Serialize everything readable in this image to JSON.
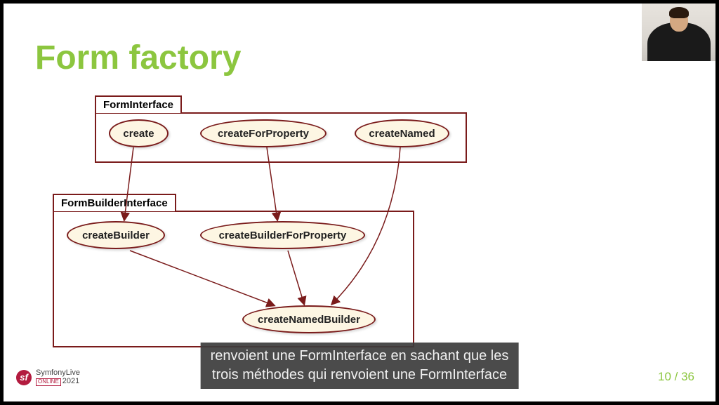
{
  "title": "Form factory",
  "boxes": {
    "box1_label": "FormInterface",
    "box2_label": "FormBuilderInterface"
  },
  "nodes": {
    "create": "create",
    "createForProperty": "createForProperty",
    "createNamed": "createNamed",
    "createBuilder": "createBuilder",
    "createBuilderForProperty": "createBuilderForProperty",
    "createNamedBuilder": "createNamedBuilder"
  },
  "subtitle": "renvoient une FormInterface en sachant que les\ntrois méthodes qui renvoient une FormInterface",
  "page": {
    "current": "10",
    "total": "36",
    "display": "10 / 36"
  },
  "logo": {
    "brand": "SymfonyLive",
    "sub_tag": "ONLINE",
    "year": "2021",
    "badge": "sf"
  }
}
